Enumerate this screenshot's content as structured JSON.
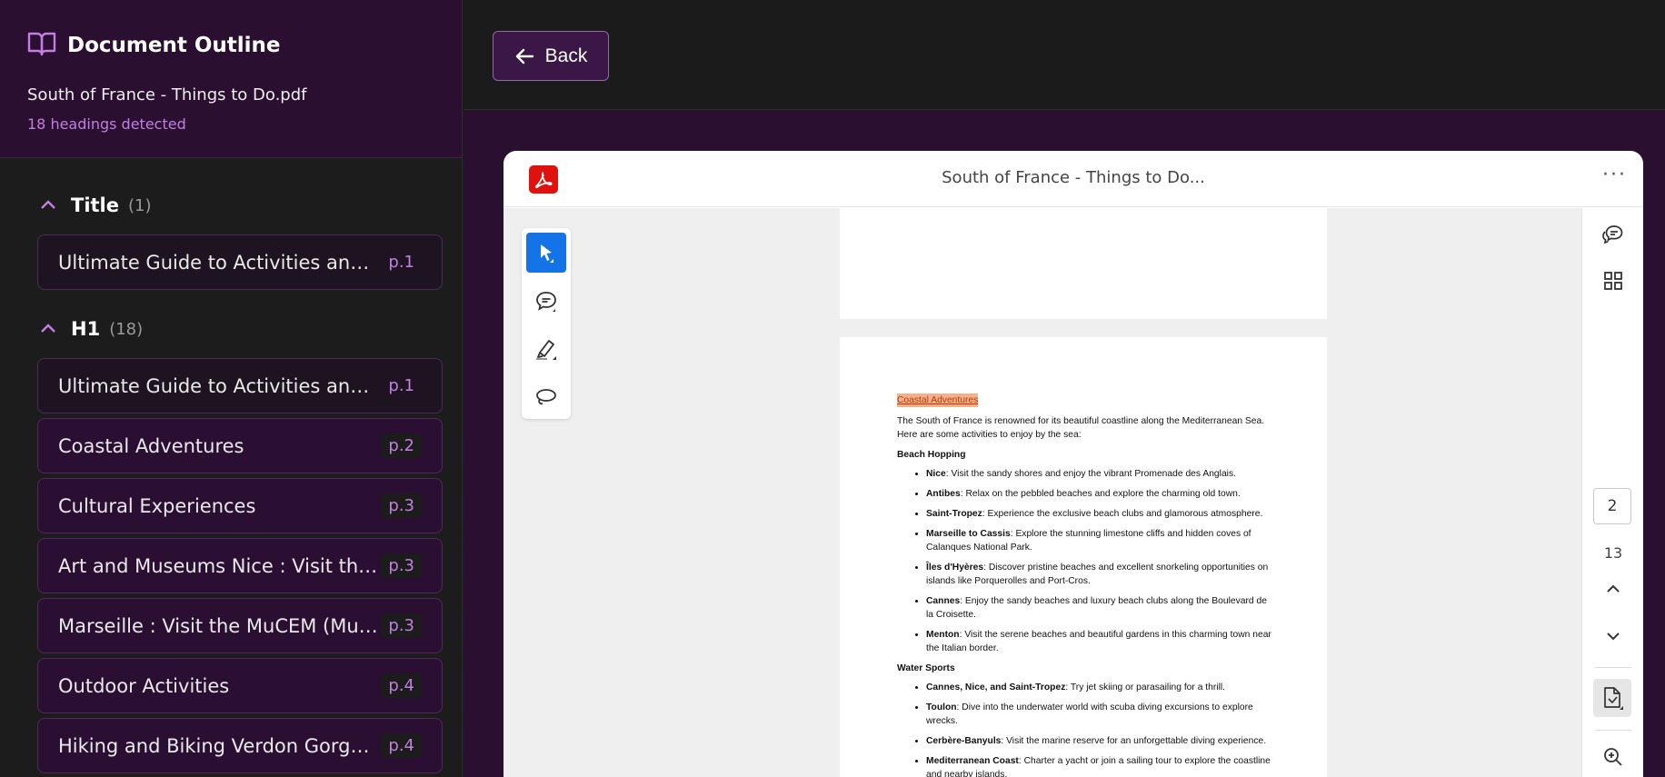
{
  "sidebar": {
    "title": "Document Outline",
    "file_name": "South of France - Things to Do.pdf",
    "headings_detected": "18 headings detected",
    "groups": [
      {
        "name": "Title",
        "count": "(1)",
        "items": [
          {
            "label": "Ultimate Guide to Activities and Th…",
            "page": "p.1"
          }
        ]
      },
      {
        "name": "H1",
        "count": "(18)",
        "items": [
          {
            "label": "Ultimate Guide to Activities and Th…",
            "page": "p.1"
          },
          {
            "label": "Coastal Adventures",
            "page": "p.2"
          },
          {
            "label": "Cultural Experiences",
            "page": "p.3"
          },
          {
            "label": "Art and Museums Nice : Visit the M…",
            "page": "p.3"
          },
          {
            "label": "Marseille : Visit the MuCEM (Muse…",
            "page": "p.3"
          },
          {
            "label": "Outdoor Activities",
            "page": "p.4"
          },
          {
            "label": "Hiking and Biking Verdon Gorge : K…",
            "page": "p.4"
          }
        ]
      }
    ]
  },
  "topbar": {
    "back_label": "Back"
  },
  "viewer": {
    "title": "South of France - Things to Do...",
    "more": "···",
    "current_page": "2",
    "total_pages": "13",
    "page_content": {
      "heading": "Coastal Adventures",
      "intro": "The South of France is renowned for its beautiful coastline along the Mediterranean Sea. Here are some activities to enjoy by the sea:",
      "sections": [
        {
          "title": "Beach Hopping",
          "items": [
            {
              "name": "Nice",
              "text": ": Visit the sandy shores and enjoy the vibrant Promenade des Anglais."
            },
            {
              "name": "Antibes",
              "text": ": Relax on the pebbled beaches and explore the charming old town."
            },
            {
              "name": "Saint-Tropez",
              "text": ": Experience the exclusive beach clubs and glamorous atmosphere."
            },
            {
              "name": "Marseille to Cassis",
              "text": ": Explore the stunning limestone cliffs and hidden coves of Calanques National Park."
            },
            {
              "name": "Îles d'Hyères",
              "text": ": Discover pristine beaches and excellent snorkeling opportunities on islands like Porquerolles and Port-Cros."
            },
            {
              "name": "Cannes",
              "text": ": Enjoy the sandy beaches and luxury beach clubs along the Boulevard de la Croisette."
            },
            {
              "name": "Menton",
              "text": ": Visit the serene beaches and beautiful gardens in this charming town near the Italian border."
            }
          ]
        },
        {
          "title": "Water Sports",
          "items": [
            {
              "name": "Cannes, Nice, and Saint-Tropez",
              "text": ": Try jet skiing or parasailing for a thrill."
            },
            {
              "name": "Toulon",
              "text": ": Dive into the underwater world with scuba diving excursions to explore wrecks."
            },
            {
              "name": "Cerbère-Banyuls",
              "text": ": Visit the marine reserve for an unforgettable diving experience."
            },
            {
              "name": "Mediterranean Coast",
              "text": ": Charter a yacht or join a sailing tour to explore the coastline and nearby islands."
            }
          ]
        }
      ]
    }
  },
  "colors": {
    "accent_purple": "#c27fe0",
    "sidebar_header_bg": "#2a0f31",
    "select_tool_blue": "#1473e6",
    "pdf_red": "#e0120f",
    "highlight": "#f5b08a"
  }
}
